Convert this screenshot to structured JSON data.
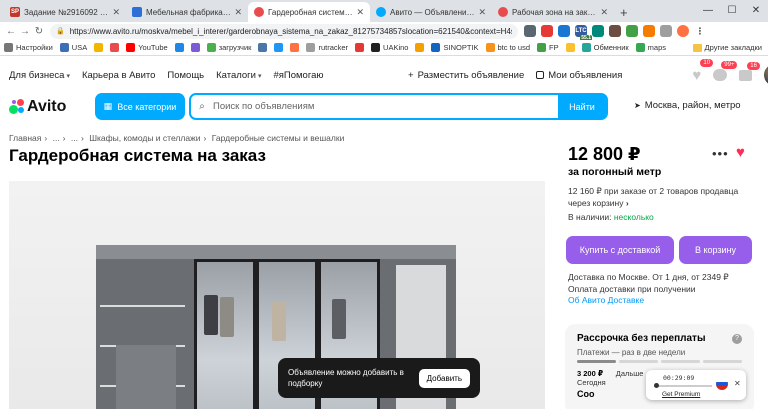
{
  "browser": {
    "tabs": [
      {
        "title": "Задание №2916092 - просмо...",
        "favicon_text": "SP",
        "favicon_color": "#c0392b",
        "active": false
      },
      {
        "title": "Мебельная фабрика Комфор...",
        "favicon_text": "",
        "favicon_color": "#2d6fd6",
        "active": false
      },
      {
        "title": "Гардеробная система на заказ",
        "favicon_text": "",
        "favicon_color": "#e84d4d",
        "active": true
      },
      {
        "title": "Авито — Объявления на сайт...",
        "favicon_text": "",
        "favicon_color": "#00aaff",
        "active": false
      },
      {
        "title": "Рабочая зона на заказ купит...",
        "favicon_text": "",
        "favicon_color": "#e84d4d",
        "active": false
      }
    ],
    "new_tab": "+",
    "url": "https://www.avito.ru/moskva/mebel_i_interer/garderobnaya_sistema_na_zakaz_81275734857slocation=621540&context=H4sIAA...",
    "extension_badge": "55.1",
    "extension_label": "LTC"
  },
  "bookmarks": {
    "items": [
      {
        "label": "Настройки",
        "color": "#777777"
      },
      {
        "label": "USA",
        "color": "#3c6fb5"
      },
      {
        "label": "",
        "color": "#f5b400"
      },
      {
        "label": "",
        "color": "#e84d4d"
      },
      {
        "label": "YouTube",
        "color": "#ff0000"
      },
      {
        "label": "",
        "color": "#1e88e5"
      },
      {
        "label": "",
        "color": "#7b5cd6"
      },
      {
        "label": "загрузчик",
        "color": "#4caf50"
      },
      {
        "label": "",
        "color": "#4a76a8"
      },
      {
        "label": "",
        "color": "#2196f3"
      },
      {
        "label": "",
        "color": "#ff7043"
      },
      {
        "label": "rutracker",
        "color": "#9e9e9e"
      },
      {
        "label": "",
        "color": "#e53935"
      },
      {
        "label": "UAKino",
        "color": "#212121"
      },
      {
        "label": "",
        "color": "#f4a100"
      },
      {
        "label": "SINOPTIK",
        "color": "#1565c0"
      },
      {
        "label": "btc to usd",
        "color": "#f7931a"
      },
      {
        "label": "FP",
        "color": "#43a047"
      },
      {
        "label": "",
        "color": "#fbc02d"
      },
      {
        "label": "Обменник",
        "color": "#26a69a"
      },
      {
        "label": "maps",
        "color": "#34a853"
      }
    ],
    "other": "Другие закладки"
  },
  "avito": {
    "top_links": [
      "Для бизнеса",
      "Карьера в Авито",
      "Помощь",
      "Каталоги",
      "#яПомогаю"
    ],
    "post_ad": "Разместить объявление",
    "my_ads": "Мои объявления",
    "counts": {
      "favorites": "10",
      "messages": "99+",
      "cart": "16"
    },
    "logo": "Avito",
    "all_categories": "Все категории",
    "search_placeholder": "Поиск по объявлениям",
    "find": "Найти",
    "location": "Москва, район, метро"
  },
  "breadcrumb": [
    "Главная",
    "...",
    "...",
    "Шкафы, комоды и стеллажи",
    "Гардеробные системы и вешалки"
  ],
  "listing": {
    "title": "Гардеробная система на заказ",
    "price": "12 800 ₽",
    "price_unit": "за погонный метр",
    "order_note": "12 160 ₽ при заказе от 2 товаров продавца через корзину",
    "stock_label": "В наличии:",
    "stock_value": "несколько",
    "buy_delivery": "Купить с доставкой",
    "add_to_cart": "В корзину",
    "delivery_line1": "Доставка по Москве. От 1 дня, от 2349 ₽",
    "delivery_line2": "Оплата доставки при получении",
    "delivery_link": "Об Авито Доставке"
  },
  "installment": {
    "title": "Рассрочка без переплаты",
    "subtitle": "Платежи — раз в две недели",
    "first_amount": "3 200 ₽",
    "first_label": "Сегодня",
    "second_label": "Дальше",
    "third_label": "Coo"
  },
  "toast": {
    "text": "Объявление можно добавить в подборку",
    "button": "Добавить"
  },
  "recorder": {
    "time": "00:29:09",
    "premium": "Get Premium"
  },
  "colors": {
    "avito_blue": "#00aaff",
    "avito_purple": "#965eeb",
    "in_stock": "#02a846",
    "link": "#0099f7",
    "heart": "#ff2d55"
  }
}
